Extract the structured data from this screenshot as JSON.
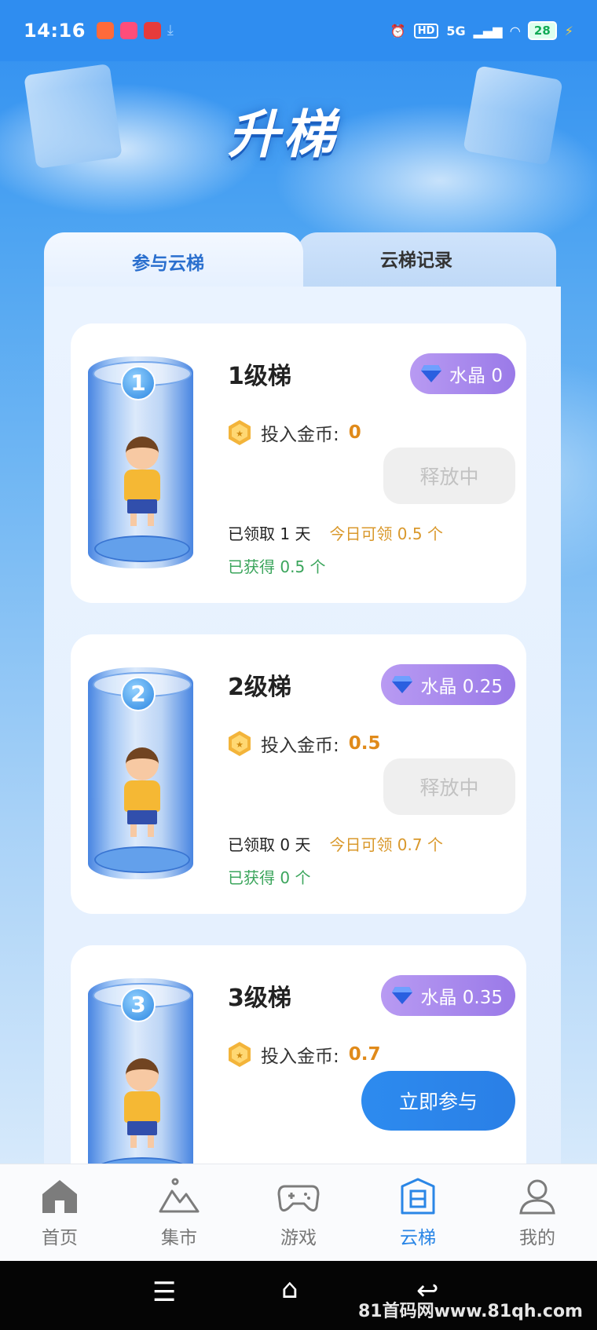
{
  "status_bar": {
    "time": "14:16",
    "network": "5G",
    "hd": "HD",
    "battery": "28"
  },
  "page": {
    "title": "升梯"
  },
  "tabs": [
    {
      "label": "参与云梯",
      "active": true
    },
    {
      "label": "云梯记录",
      "active": false
    }
  ],
  "cards": [
    {
      "number": "1",
      "level": "1级梯",
      "crystal": "水晶 0",
      "invest_label": "投入金币:",
      "invest_value": "0",
      "button": "释放中",
      "claimed": "已领取 1 天",
      "today": "今日可领 0.5 个",
      "earned": "已获得 0.5 个"
    },
    {
      "number": "2",
      "level": "2级梯",
      "crystal": "水晶 0.25",
      "invest_label": "投入金币:",
      "invest_value": "0.5",
      "button": "释放中",
      "claimed": "已领取 0 天",
      "today": "今日可领 0.7 个",
      "earned": "已获得 0 个"
    },
    {
      "number": "3",
      "level": "3级梯",
      "crystal": "水晶 0.35",
      "invest_label": "投入金币:",
      "invest_value": "0.7",
      "button": "立即参与"
    }
  ],
  "bottom_nav": [
    {
      "label": "首页",
      "icon": "home-icon"
    },
    {
      "label": "集市",
      "icon": "mountain-icon"
    },
    {
      "label": "游戏",
      "icon": "gamepad-icon"
    },
    {
      "label": "云梯",
      "icon": "elevator-icon",
      "active": true
    },
    {
      "label": "我的",
      "icon": "user-icon"
    }
  ],
  "watermark": "81首码网www.81qh.com",
  "colors": {
    "accent": "#2a86e6",
    "coin_value": "#e08a1a",
    "today": "#d9982b",
    "earned": "#3ba55c",
    "crystal_badge": "#a98af0"
  }
}
